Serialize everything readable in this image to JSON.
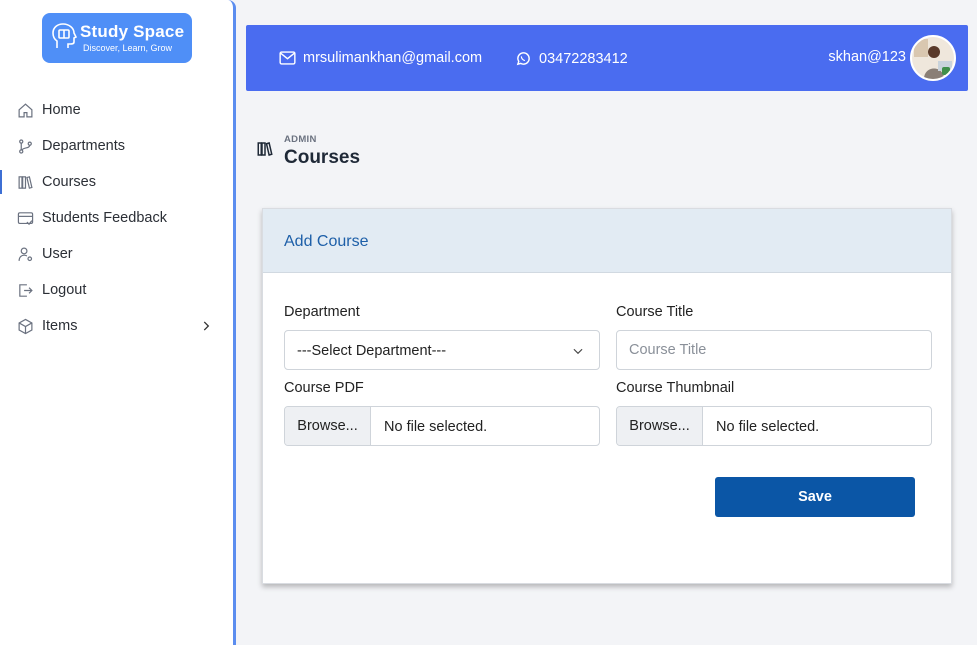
{
  "brand": {
    "title": "Study Space",
    "tagline": "Discover, Learn, Grow",
    "logo_icon": "head-book-icon",
    "color": "#4f8ff7"
  },
  "sidebar": {
    "items": [
      {
        "label": "Home",
        "icon": "home-icon"
      },
      {
        "label": "Departments",
        "icon": "git-branch-icon"
      },
      {
        "label": "Courses",
        "icon": "books-icon",
        "active": true
      },
      {
        "label": "Students Feedback",
        "icon": "feedback-card-icon"
      },
      {
        "label": "User",
        "icon": "user-gear-icon"
      },
      {
        "label": "Logout",
        "icon": "logout-icon"
      },
      {
        "label": "Items",
        "icon": "box-icon",
        "expandable": true
      }
    ],
    "accent": "#5b8def"
  },
  "topbar": {
    "email": "mrsulimankhan@gmail.com",
    "phone": "03472283412",
    "username": "skhan@123",
    "background": "#4a6cf0"
  },
  "page": {
    "breadcrumb": "ADMIN",
    "title": "Courses"
  },
  "form": {
    "card_title": "Add Course",
    "department_label": "Department",
    "department_value": "---Select Department---",
    "course_title_label": "Course Title",
    "course_title_placeholder": "Course Title",
    "course_pdf_label": "Course PDF",
    "course_thumbnail_label": "Course Thumbnail",
    "browse_label": "Browse...",
    "no_file_text": "No file selected.",
    "save_label": "Save",
    "save_color": "#0b56a6"
  }
}
